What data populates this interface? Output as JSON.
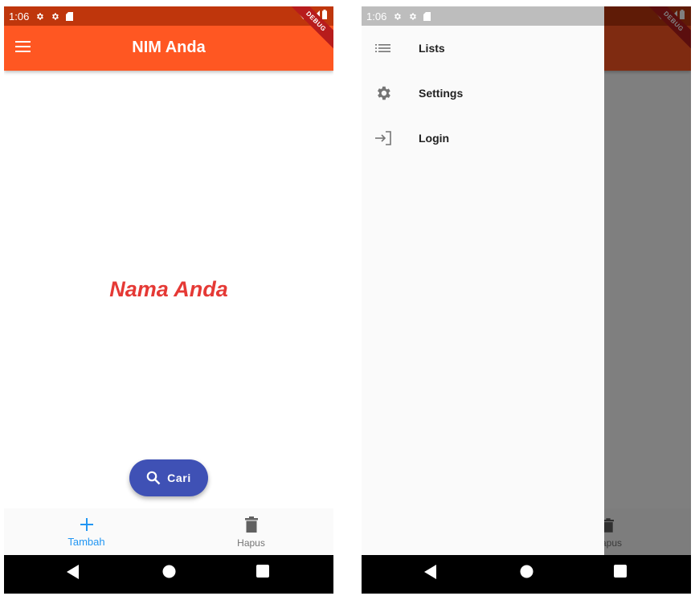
{
  "status_bar": {
    "time": "1:06"
  },
  "app_bar": {
    "title": "NIM Anda"
  },
  "debug_banner": "DEBUG",
  "main": {
    "name_text": "Nama Anda"
  },
  "fab": {
    "label": "Cari"
  },
  "bottom_nav": {
    "items": [
      {
        "label": "Tambah",
        "icon": "add-icon",
        "active": true
      },
      {
        "label": "Hapus",
        "icon": "delete-icon",
        "active": false
      }
    ],
    "partial_label": "apus"
  },
  "drawer": {
    "items": [
      {
        "label": "Lists",
        "icon": "list-icon"
      },
      {
        "label": "Settings",
        "icon": "settings-icon"
      },
      {
        "label": "Login",
        "icon": "login-icon"
      }
    ]
  },
  "colors": {
    "primary": "#ff5722",
    "name_text": "#e53935",
    "fab": "#3f51b5",
    "nav_active": "#2196f3"
  }
}
